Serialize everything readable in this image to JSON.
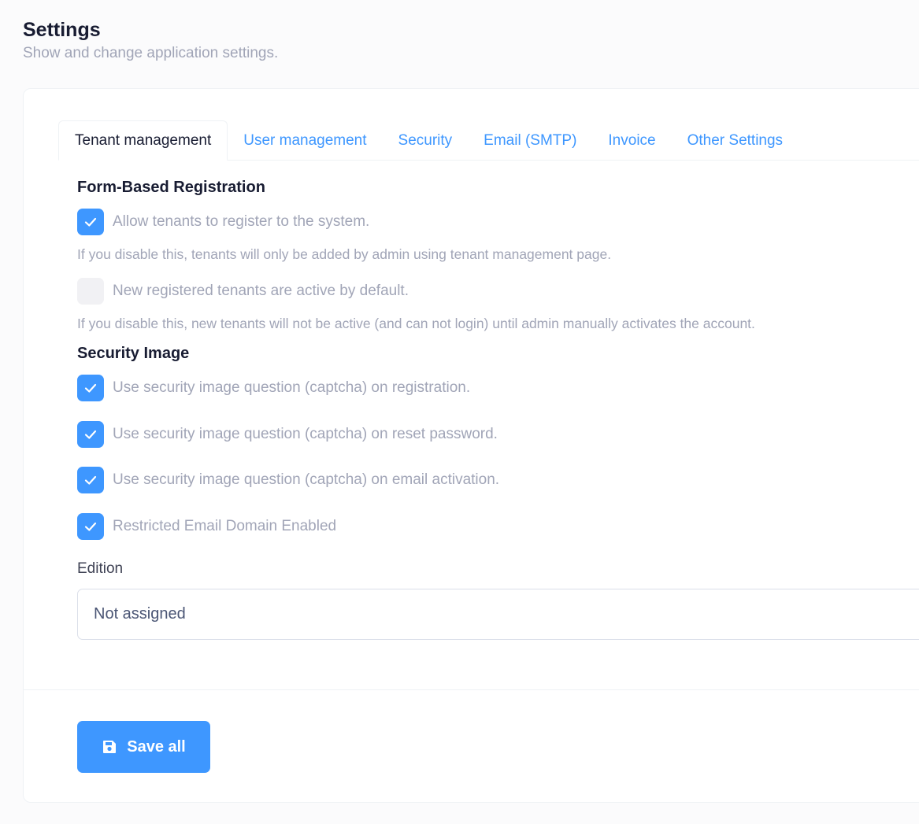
{
  "header": {
    "title": "Settings",
    "subtitle": "Show and change application settings."
  },
  "tabs": [
    {
      "label": "Tenant management",
      "active": true
    },
    {
      "label": "User management",
      "active": false
    },
    {
      "label": "Security",
      "active": false
    },
    {
      "label": "Email (SMTP)",
      "active": false
    },
    {
      "label": "Invoice",
      "active": false
    },
    {
      "label": "Other Settings",
      "active": false
    }
  ],
  "form_registration": {
    "title": "Form-Based Registration",
    "allow_register": {
      "label": "Allow tenants to register to the system.",
      "checked": true,
      "hint": "If you disable this, tenants will only be added by admin using tenant management page."
    },
    "active_default": {
      "label": "New registered tenants are active by default.",
      "checked": false,
      "hint": "If you disable this, new tenants will not be active (and can not login) until admin manually activates the account."
    }
  },
  "security_image": {
    "title": "Security Image",
    "options": [
      {
        "label": "Use security image question (captcha) on registration.",
        "checked": true
      },
      {
        "label": "Use security image question (captcha) on reset password.",
        "checked": true
      },
      {
        "label": "Use security image question (captcha) on email activation.",
        "checked": true
      },
      {
        "label": "Restricted Email Domain Enabled",
        "checked": true
      }
    ]
  },
  "edition": {
    "label": "Edition",
    "value": "Not assigned"
  },
  "footer": {
    "save_label": "Save all"
  },
  "colors": {
    "accent": "#3e97ff",
    "muted_text": "#a1a5b7",
    "heading": "#181c32"
  },
  "icons": {
    "checkbox_check": "check-icon",
    "save": "floppy-disk-icon"
  }
}
